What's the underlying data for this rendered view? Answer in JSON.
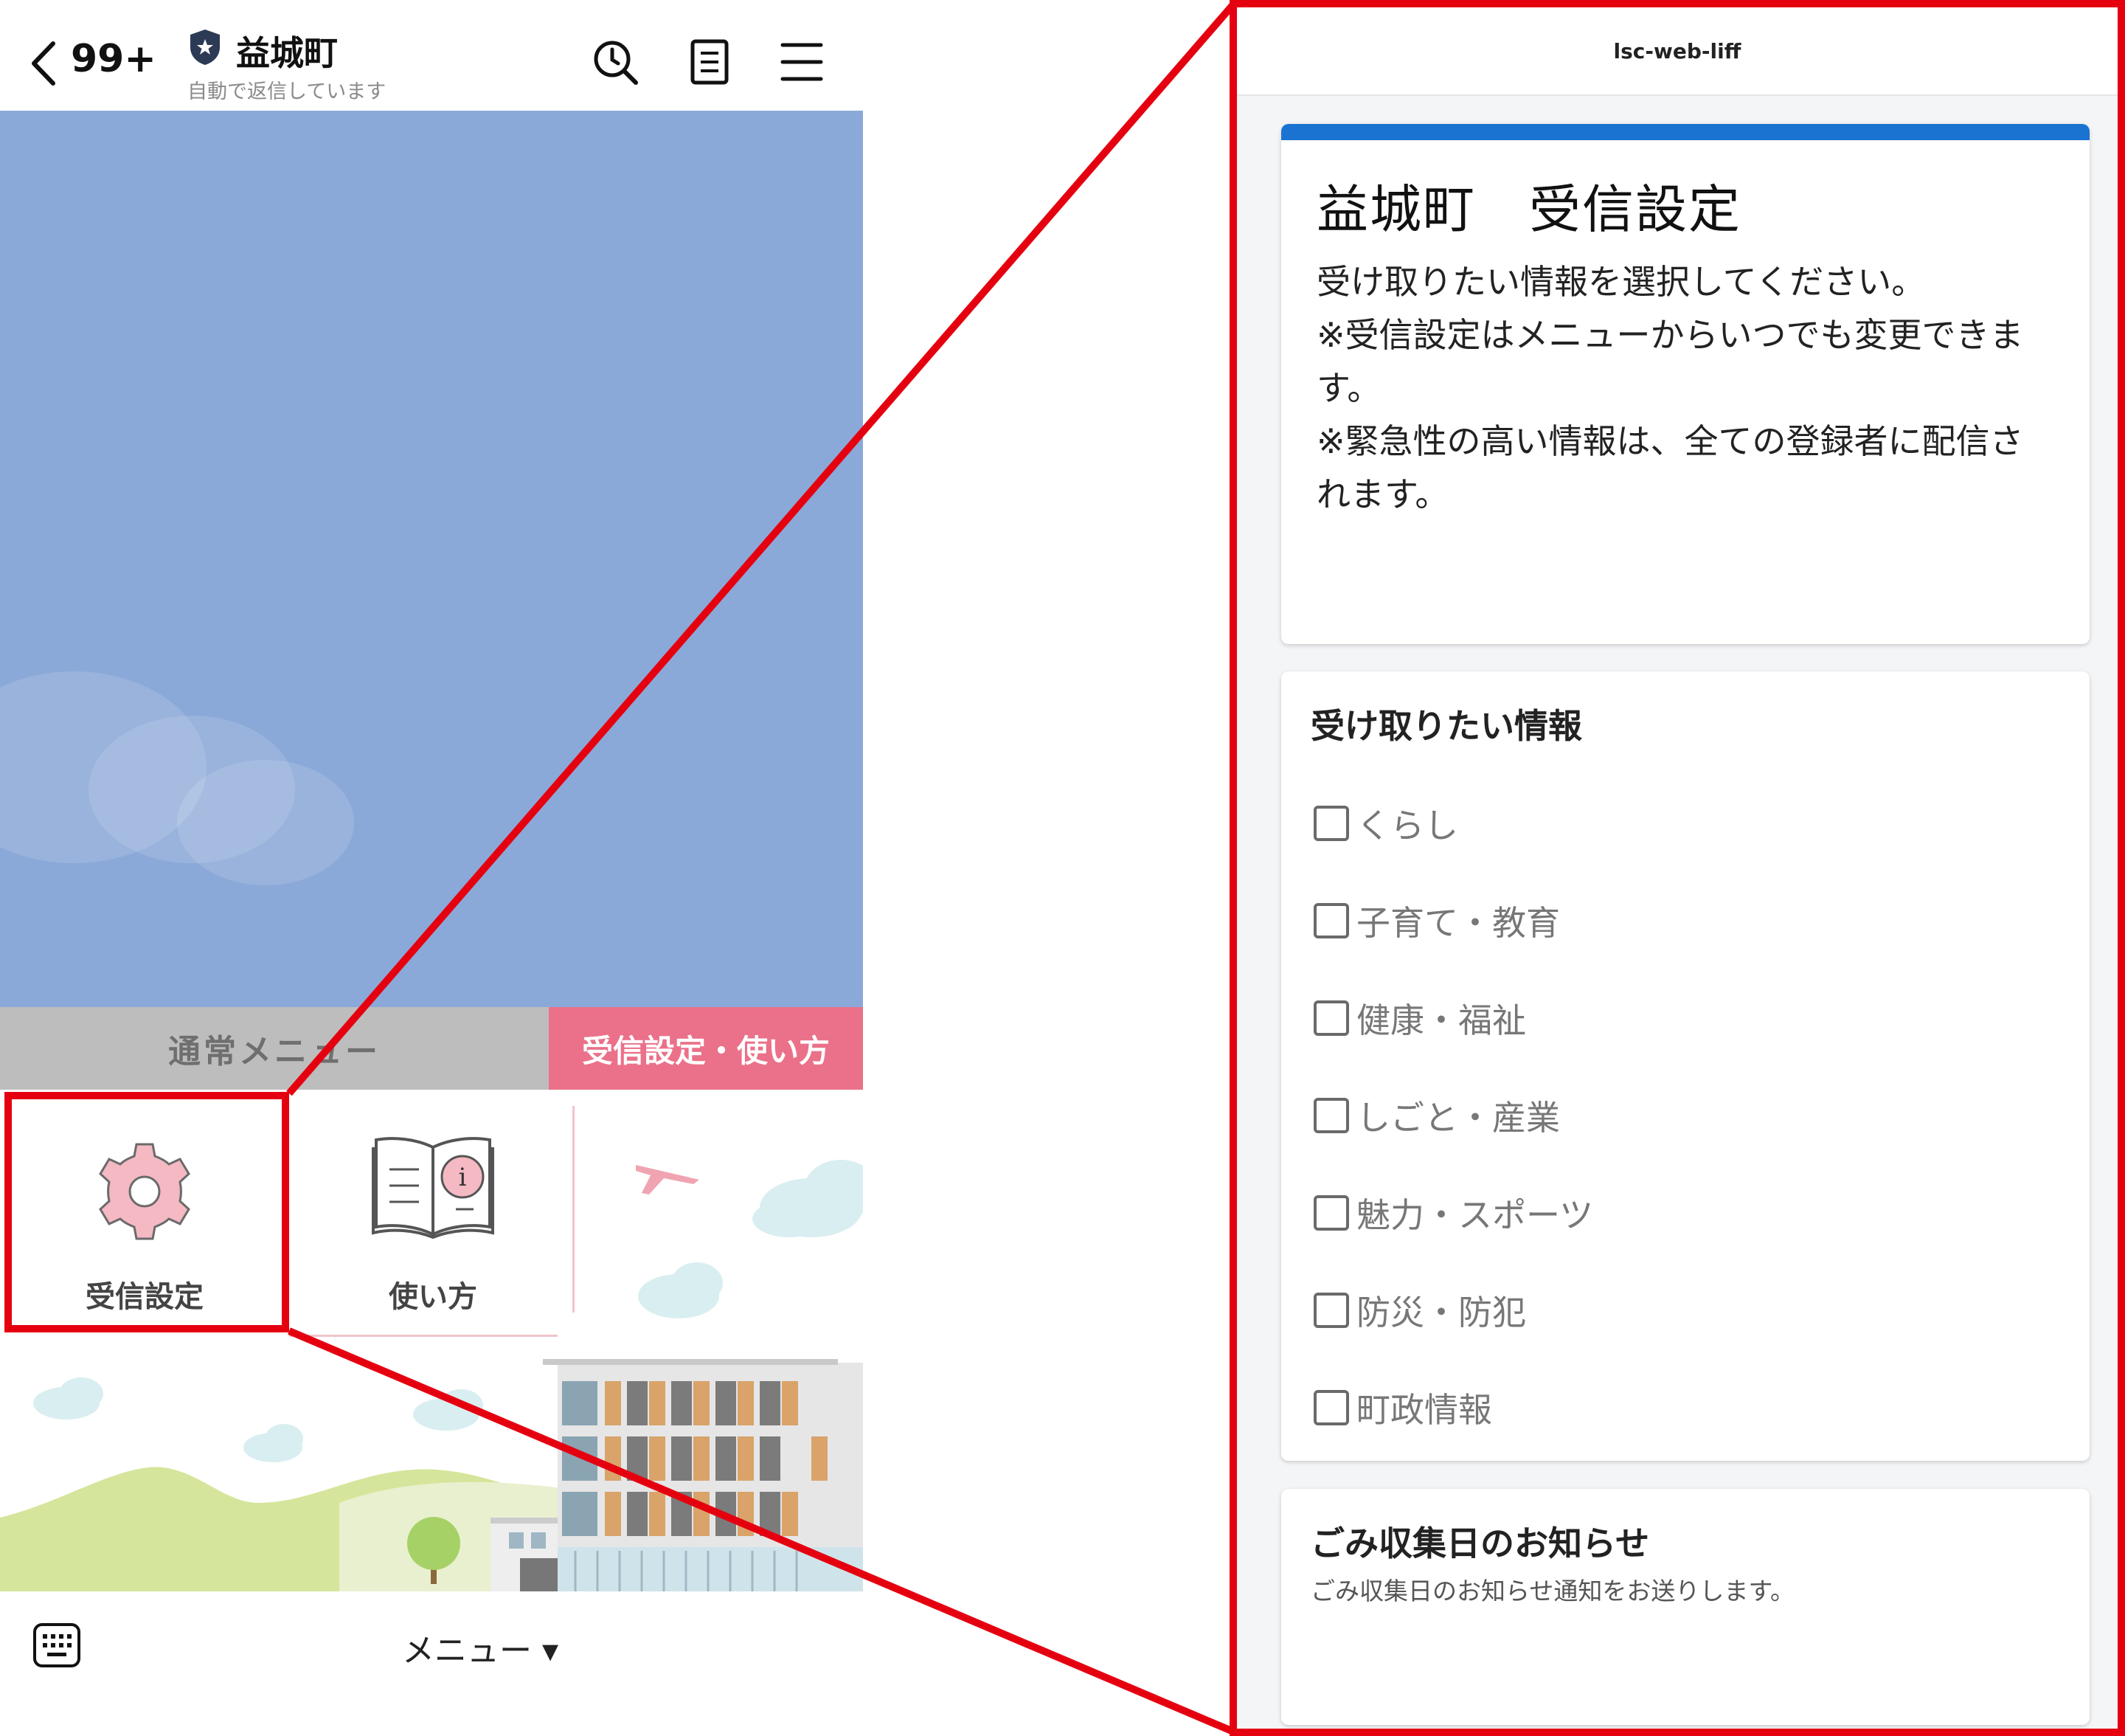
{
  "chat_header": {
    "unread_count": "99+",
    "account_name": "益城町",
    "status": "自動で返信しています"
  },
  "rich_menu": {
    "tabs": [
      "通常メニュー",
      "受信設定・使い方"
    ],
    "items": [
      {
        "label": "受信設定",
        "icon": "gear-icon"
      },
      {
        "label": "使い方",
        "icon": "book-info-icon"
      }
    ]
  },
  "chat_bottom": {
    "menu_label": "メニュー ▾"
  },
  "liff": {
    "app_title": "lsc-web-liff",
    "intro": {
      "title": "益城町　受信設定",
      "lines": [
        "受け取りたい情報を選択してください。",
        "※受信設定はメニューからいつでも変更できま",
        "す。",
        "※緊急性の高い情報は、全ての登録者に配信さ",
        "れます。"
      ]
    },
    "topics": {
      "heading": "受け取りたい情報",
      "options": [
        "くらし",
        "子育て・教育",
        "健康・福祉",
        "しごと・産業",
        "魅力・スポーツ",
        "防災・防犯",
        "町政情報"
      ]
    },
    "garbage": {
      "heading": "ごみ収集日のお知らせ",
      "description": "ごみ収集日のお知らせ通知をお送りします。"
    }
  },
  "colors": {
    "highlight": "#e50010",
    "settings_tab": "#ea7189",
    "chat_background": "#8ba9d8",
    "accent_bar": "#1a73d0"
  }
}
